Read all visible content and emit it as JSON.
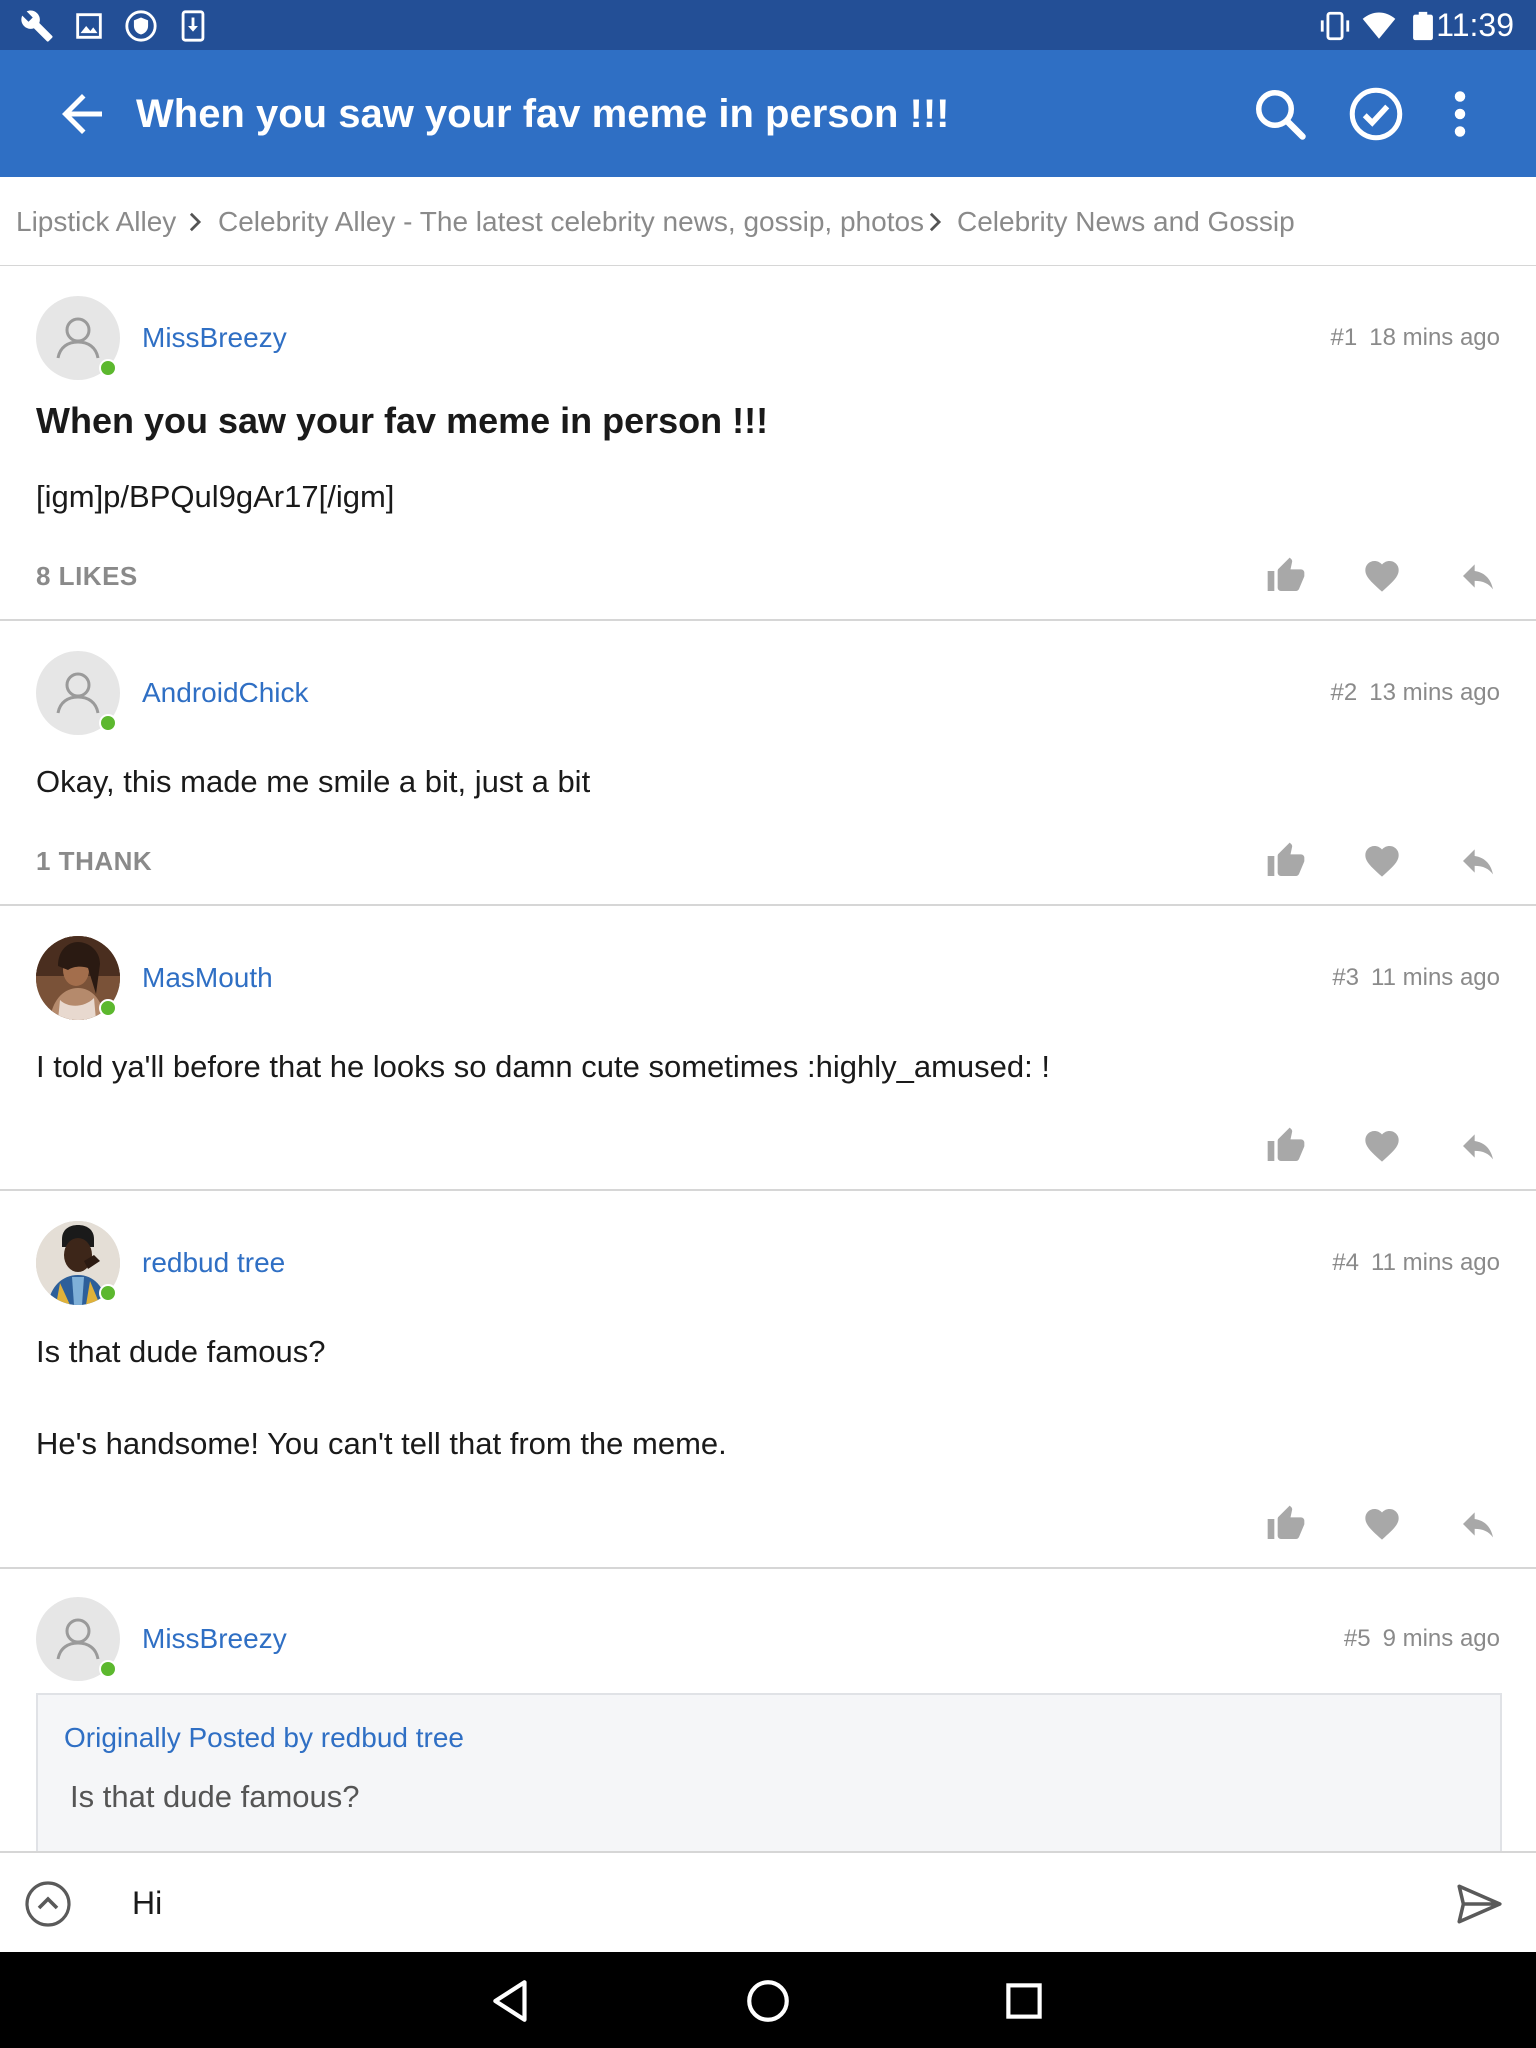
{
  "status_bar": {
    "time": "11:39",
    "left_icons": [
      "wrench-icon",
      "image-icon",
      "shield-icon",
      "download-icon"
    ],
    "right_icons": [
      "vibrate-icon",
      "wifi-icon",
      "battery-icon"
    ]
  },
  "app_bar": {
    "title": "When you saw your fav meme in person !!!",
    "icons": [
      "back-arrow-icon",
      "search-icon",
      "check-circle-icon",
      "more-vert-icon"
    ]
  },
  "breadcrumb": [
    "Lipstick Alley",
    "Celebrity Alley - The latest celebrity news, gossip, photos",
    "Celebrity News and Gossip"
  ],
  "colors": {
    "status_bar": "#234f96",
    "app_bar": "#2f6fc4",
    "link": "#2f6fc4",
    "online": "#5cb82e"
  },
  "posts": [
    {
      "author": "MissBreezy",
      "number": "#1",
      "time": "18 mins ago",
      "title": "When you saw your fav meme in person !!!",
      "body": [
        "[igm]p/BPQul9gAr17[/igm]"
      ],
      "reactions": "8 LIKES",
      "avatar": "default"
    },
    {
      "author": "AndroidChick",
      "number": "#2",
      "time": "13 mins ago",
      "body": [
        "Okay, this made me smile a bit, just a bit"
      ],
      "reactions": "1 THANK",
      "avatar": "default"
    },
    {
      "author": "MasMouth",
      "number": "#3",
      "time": "11 mins ago",
      "body": [
        "I told ya'll before that he looks so damn cute sometimes :highly_amused: !"
      ],
      "reactions": "",
      "avatar": "photo"
    },
    {
      "author": "redbud tree",
      "number": "#4",
      "time": "11 mins ago",
      "body": [
        "Is that dude famous?",
        "He's handsome! You can't tell that from the meme."
      ],
      "reactions": "",
      "avatar": "photo"
    },
    {
      "author": "MissBreezy",
      "number": "#5",
      "time": "9 mins ago",
      "quote": {
        "by": "Originally Posted by redbud tree",
        "text": "Is that dude famous?"
      },
      "avatar": "default"
    }
  ],
  "post_actions": [
    "thumbs-up-icon",
    "heart-icon",
    "reply-icon"
  ],
  "reply_bar": {
    "value": "Hi",
    "icons": [
      "expand-up-icon",
      "send-icon"
    ]
  },
  "nav_bar": {
    "icons": [
      "back-triangle-icon",
      "home-circle-icon",
      "recents-square-icon"
    ]
  }
}
